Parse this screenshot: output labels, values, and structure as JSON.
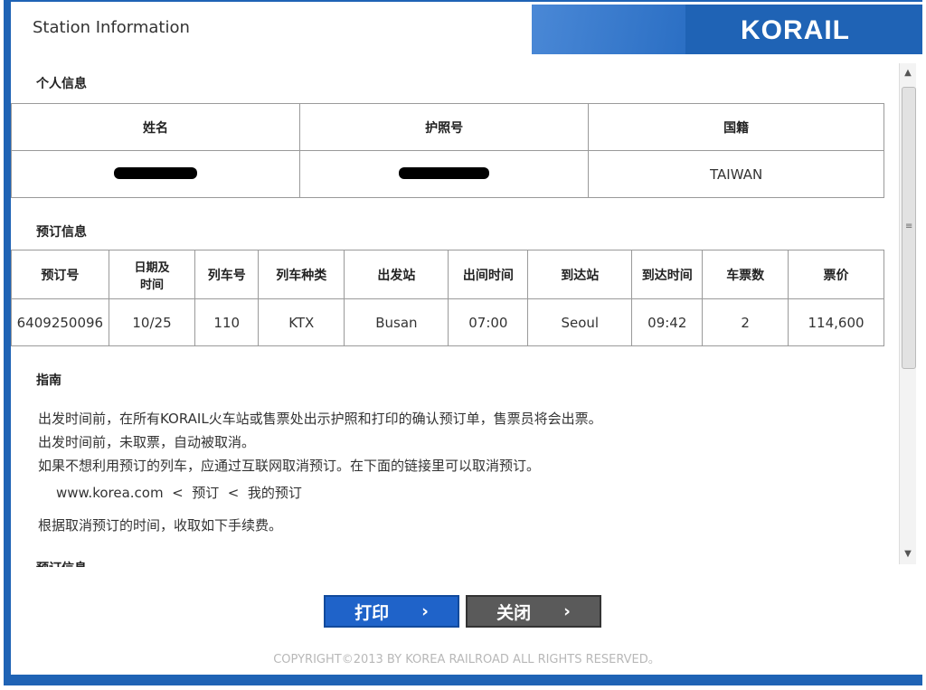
{
  "window": {
    "title": "Station Information",
    "logo": "KORAIL"
  },
  "personal": {
    "section_title": "个人信息",
    "headers": [
      "姓名",
      "护照号",
      "国籍"
    ],
    "values": {
      "name": "",
      "passport": "",
      "nationality": "TAIWAN"
    }
  },
  "reservation": {
    "section_title": "预订信息",
    "headers": [
      "预订号",
      "日期及时间",
      "列车号",
      "列车种类",
      "出发站",
      "出间时间",
      "到达站",
      "到达时间",
      "车票数",
      "票价"
    ],
    "row": [
      "6409250096",
      "10/25",
      "110",
      "KTX",
      "Busan",
      "07:00",
      "Seoul",
      "09:42",
      "2",
      "114,600"
    ]
  },
  "guide": {
    "section_title": "指南",
    "lines": [
      "出发时间前，在所有KORAIL火车站或售票处出示护照和打印的确认预订单，售票员将会出票。",
      "出发时间前，未取票，自动被取消。",
      "如果不想利用预订的列车，应通过互联网取消预订。在下面的链接里可以取消预订。",
      "www.korea.com  <  预订  <  我的预订",
      "根据取消预订的时间，收取如下手续费。"
    ],
    "next_section_partial": "预订信息"
  },
  "buttons": {
    "print": "打印",
    "close": "关闭",
    "arrow": "›"
  },
  "copyright": "COPYRIGHT©2013 BY KOREA RAILROAD ALL RIGHTS RESERVED。",
  "colors": {
    "brand": "#1f63b5",
    "print_button": "#1f63c9",
    "close_button": "#5a5a5a"
  }
}
